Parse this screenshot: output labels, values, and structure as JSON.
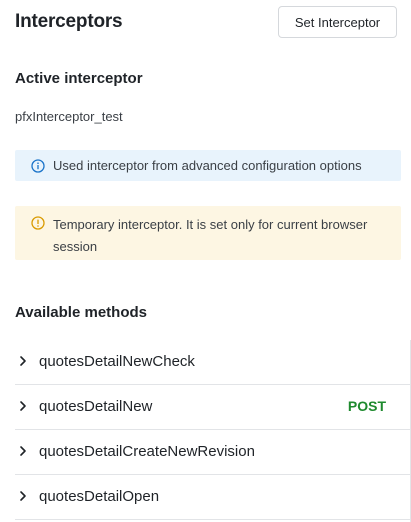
{
  "header": {
    "title": "Interceptors",
    "set_interceptor_label": "Set Interceptor"
  },
  "active": {
    "heading": "Active interceptor",
    "value": "pfxInterceptor_test"
  },
  "info_banner": {
    "icon": "info-icon",
    "color": "#1a73c9",
    "background": "#e8f3fc",
    "text": "Used interceptor from advanced configuration options"
  },
  "warning_banner": {
    "icon": "warning-icon",
    "color": "#d99a00",
    "background": "#fdf6e3",
    "text": "Temporary interceptor. It is set only for current browser session"
  },
  "methods": {
    "heading": "Available methods",
    "badge_color": "#1e8a2e",
    "items": [
      {
        "name": "quotesDetailNewCheck",
        "badge": ""
      },
      {
        "name": "quotesDetailNew",
        "badge": "POST"
      },
      {
        "name": "quotesDetailCreateNewRevision",
        "badge": ""
      },
      {
        "name": "quotesDetailOpen",
        "badge": ""
      }
    ]
  }
}
